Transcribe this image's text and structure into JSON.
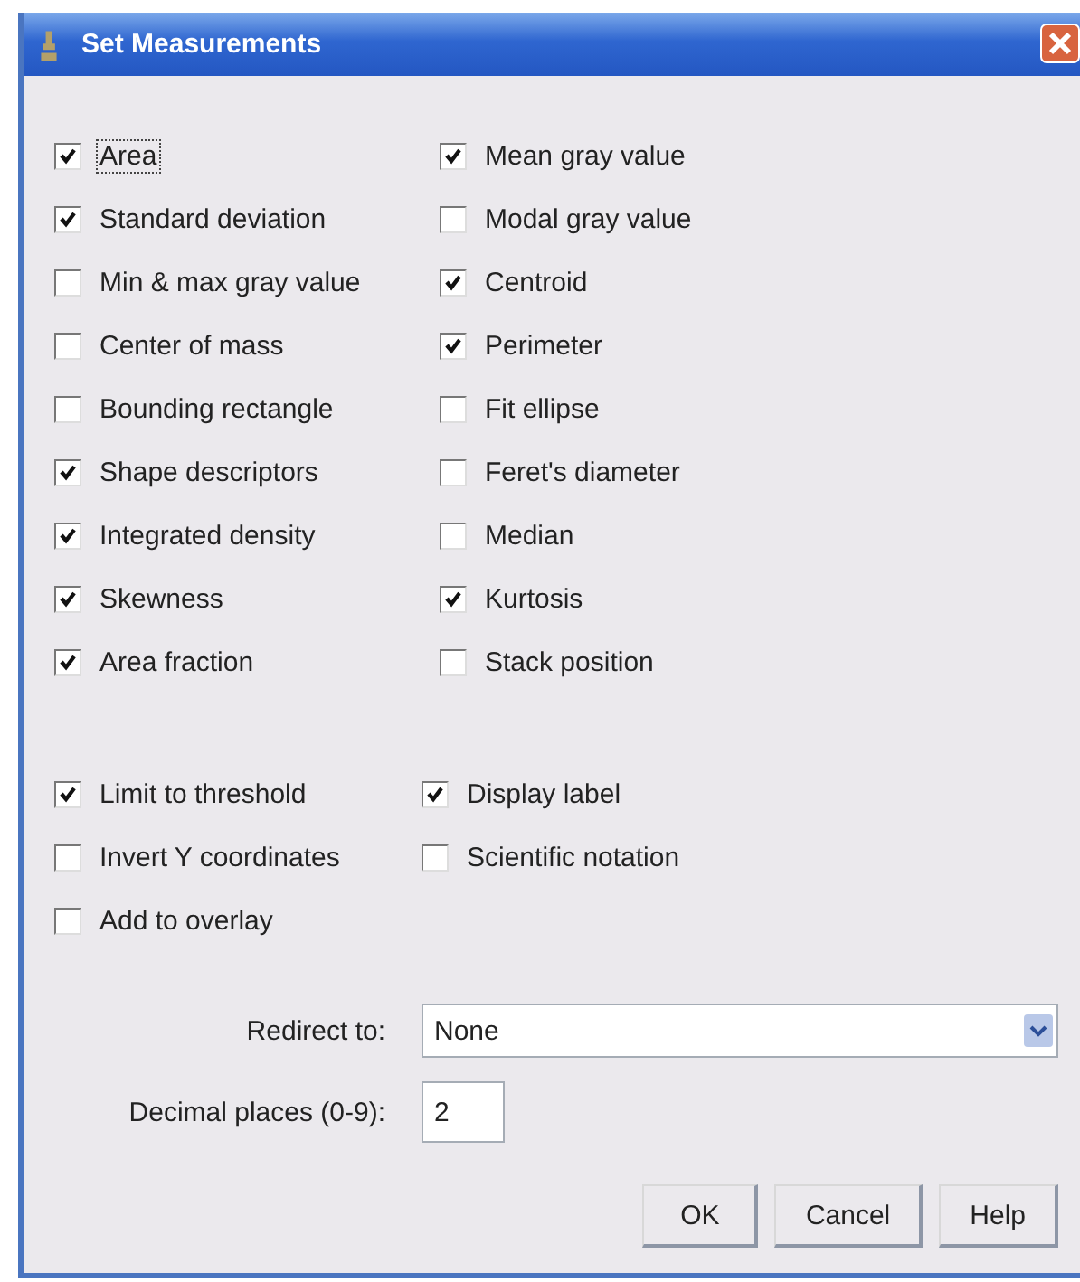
{
  "window": {
    "title": "Set Measurements"
  },
  "measurements": [
    {
      "label": "Area",
      "checked": true,
      "focused": true
    },
    {
      "label": "Mean gray value",
      "checked": true,
      "focused": false
    },
    {
      "label": "Standard deviation",
      "checked": true,
      "focused": false
    },
    {
      "label": "Modal gray value",
      "checked": false,
      "focused": false
    },
    {
      "label": "Min & max gray value",
      "checked": false,
      "focused": false
    },
    {
      "label": "Centroid",
      "checked": true,
      "focused": false
    },
    {
      "label": "Center of mass",
      "checked": false,
      "focused": false
    },
    {
      "label": "Perimeter",
      "checked": true,
      "focused": false
    },
    {
      "label": "Bounding rectangle",
      "checked": false,
      "focused": false
    },
    {
      "label": "Fit ellipse",
      "checked": false,
      "focused": false
    },
    {
      "label": "Shape descriptors",
      "checked": true,
      "focused": false
    },
    {
      "label": "Feret's diameter",
      "checked": false,
      "focused": false
    },
    {
      "label": "Integrated density",
      "checked": true,
      "focused": false
    },
    {
      "label": "Median",
      "checked": false,
      "focused": false
    },
    {
      "label": "Skewness",
      "checked": true,
      "focused": false
    },
    {
      "label": "Kurtosis",
      "checked": true,
      "focused": false
    },
    {
      "label": "Area fraction",
      "checked": true,
      "focused": false
    },
    {
      "label": "Stack position",
      "checked": false,
      "focused": false
    }
  ],
  "options": [
    {
      "label": "Limit to threshold",
      "checked": true,
      "focused": false
    },
    {
      "label": "Display label",
      "checked": true,
      "focused": false
    },
    {
      "label": "Invert Y coordinates",
      "checked": false,
      "focused": false
    },
    {
      "label": "Scientific notation",
      "checked": false,
      "focused": false
    },
    {
      "label": "Add to overlay",
      "checked": false,
      "focused": false
    }
  ],
  "redirect": {
    "label": "Redirect to:",
    "value": "None"
  },
  "decimal_places": {
    "label": "Decimal places (0-9):",
    "value": "2"
  },
  "buttons": [
    "OK",
    "Cancel",
    "Help"
  ]
}
